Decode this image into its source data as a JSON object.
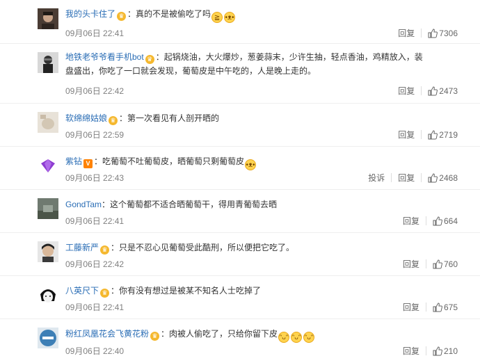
{
  "comments": [
    {
      "user": "我的头卡住了",
      "text": "：真的不是被偷吃了吗",
      "time": "09月06日 22:41",
      "reply": "回复",
      "likes": "7306"
    },
    {
      "user": "地铁老爷爷看手机bot",
      "text": "：起锅烧油，大火爆炒，葱姜蒜末，少许生抽，轻点香油，鸡精放入，装盘盛出，你吃了一口就会发现，葡萄皮是中午吃的，人是晚上走的。",
      "time": "09月06日 22:42",
      "reply": "回复",
      "likes": "2473"
    },
    {
      "user": "软绵绵姑娘",
      "text": "：第一次看见有人剖开晒的",
      "time": "09月06日 22:59",
      "reply": "回复",
      "likes": "2719"
    },
    {
      "user": "紫钻",
      "text": "：吃葡萄不吐葡萄皮，晒葡萄只剩葡萄皮",
      "time": "09月06日 22:43",
      "report": "投诉",
      "reply": "回复",
      "likes": "2468"
    },
    {
      "user": "GondTam",
      "text": "：这个葡萄都不适合晒葡萄干，得用青葡萄去晒",
      "time": "09月06日 22:41",
      "reply": "回复",
      "likes": "664"
    },
    {
      "user": "工藤新严",
      "text": "：只是不忍心见葡萄受此酷刑，所以便把它吃了。",
      "time": "09月06日 22:42",
      "reply": "回复",
      "likes": "760"
    },
    {
      "user": "八英尺下",
      "text": "：你有没有想过是被某不知名人士吃掉了",
      "time": "09月06日 22:41",
      "reply": "回复",
      "likes": "675"
    },
    {
      "user": "粉红凤凰花会飞黄花粉",
      "text": "：肉被人偷吃了，只给你留下皮",
      "time": "09月06日 22:40",
      "reply": "回复",
      "likes": "210"
    }
  ],
  "colors": {
    "username": "#eb7350",
    "username_alt": "#2a6db5",
    "time": "#808080",
    "badge": "#f5b82e"
  }
}
